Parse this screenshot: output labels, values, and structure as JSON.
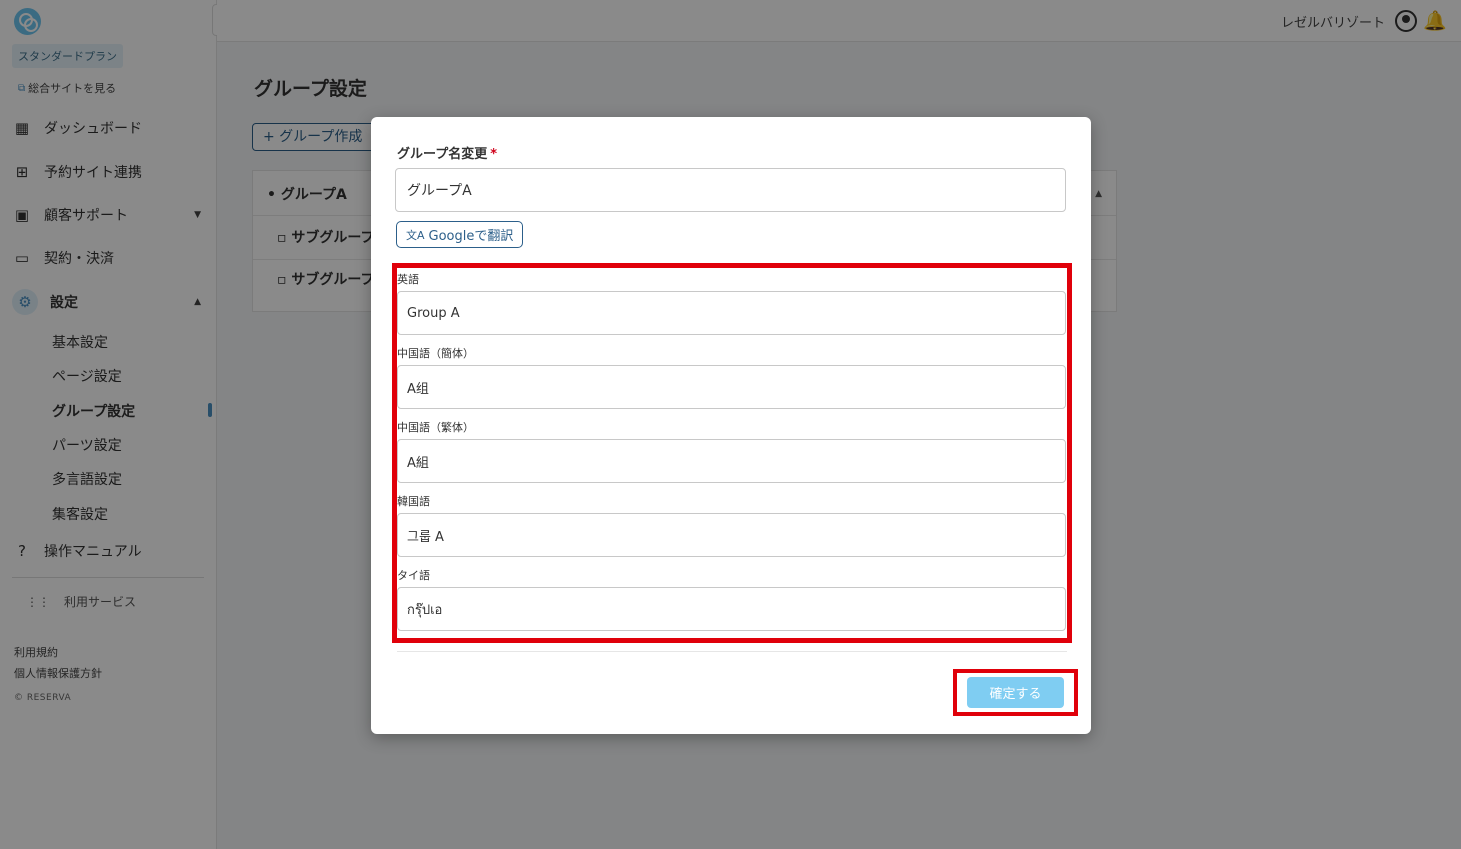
{
  "sidebar": {
    "plan": "スタンダードプラン",
    "site_link": "総合サイトを見る",
    "nav": [
      {
        "label": "ダッシュボード"
      },
      {
        "label": "予約サイト連携"
      },
      {
        "label": "顧客サポート"
      },
      {
        "label": "契約・決済"
      },
      {
        "label": "設定"
      }
    ],
    "sub": [
      {
        "label": "基本設定"
      },
      {
        "label": "ページ設定"
      },
      {
        "label": "グループ設定"
      },
      {
        "label": "パーツ設定"
      },
      {
        "label": "多言語設定"
      },
      {
        "label": "集客設定"
      }
    ],
    "manual": "操作マニュアル",
    "services": "利用サービス",
    "terms": "利用規約",
    "privacy": "個人情報保護方針",
    "copyright": "© RESERVA"
  },
  "header": {
    "user": "レゼルバリゾート"
  },
  "page": {
    "title": "グループ設定",
    "create_button": "+ グループ作成",
    "groups": [
      {
        "label": "• グループA"
      },
      {
        "label": "▫ サブグループ"
      },
      {
        "label": "▫ サブグループ"
      }
    ]
  },
  "modal": {
    "field_label": "グループ名変更",
    "required_mark": "*",
    "name_value": "グループA",
    "translate_button": "Googleで翻訳",
    "translations": [
      {
        "label": "英語",
        "value": "Group A"
      },
      {
        "label": "中国語（簡体）",
        "value": "A组"
      },
      {
        "label": "中国語（繁体）",
        "value": "A組"
      },
      {
        "label": "韓国語",
        "value": "그룹 A"
      },
      {
        "label": "タイ語",
        "value": "กรุ๊ปเอ"
      }
    ],
    "confirm_button": "確定する"
  },
  "colors": {
    "highlight": "#e0000a",
    "primary": "#2c5f8a",
    "confirm": "#7fcdf2"
  }
}
